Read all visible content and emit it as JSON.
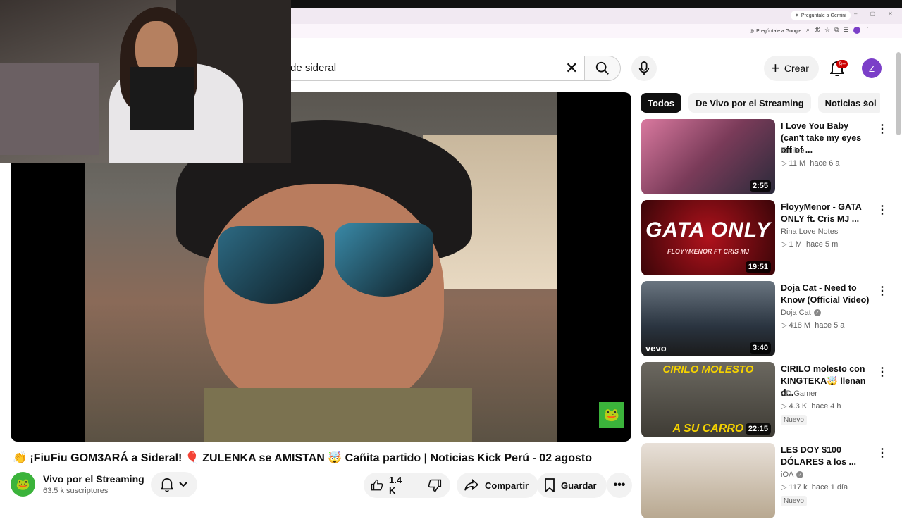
{
  "browser": {
    "gemini_button": "Pregúntale a Gemini",
    "ask_google": "Pregúntale a Google",
    "win_controls": [
      "–",
      "▢",
      "✕"
    ]
  },
  "header": {
    "search_query": "de sideral",
    "create_label": "Crear",
    "notifications_badge": "9+",
    "avatar_letter": "Z"
  },
  "video": {
    "title": "👏 ¡FiuFiu GOM3ARÁ a Sideral! 🎈 ZULENKA se AMISTAN 🤯 Cañita partido | Noticias Kick Perú - 02 agosto",
    "channel_name": "Vivo por el Streaming",
    "subscribers": "63.5 k suscriptores",
    "likes": "1.4 K",
    "share_label": "Compartir",
    "save_label": "Guardar"
  },
  "chips": [
    "Todos",
    "De Vivo por el Streaming",
    "Noticias sol"
  ],
  "recommendations": [
    {
      "title": "I Love You Baby (can't take my eyes off of ...",
      "channel": "Emilee",
      "verified": false,
      "views": "11 M",
      "age": "hace 6 a",
      "duration": "2:55",
      "new": "",
      "thumb_text": "",
      "thumb_color": "#c66a92"
    },
    {
      "title": "FloyyMenor - GATA ONLY ft. Cris MJ ...",
      "channel": "Rina Love Notes",
      "verified": false,
      "views": "1 M",
      "age": "hace 5 m",
      "duration": "19:51",
      "new": "",
      "thumb_text": "GATA ONLY",
      "thumb_sub": "FLOYYMENOR FT CRIS MJ",
      "thumb_color": "#8c0d14"
    },
    {
      "title": "Doja Cat - Need to Know (Official Video)",
      "channel": "Doja Cat",
      "verified": true,
      "views": "418 M",
      "age": "hace 5 a",
      "duration": "3:40",
      "new": "",
      "thumb_text": "vevo",
      "thumb_color": "#2a3a4a"
    },
    {
      "title": "CIRILO molesto con KINGTEKA🤯 llenan d...",
      "channel": "AD Gamer",
      "verified": false,
      "views": "4.3 K",
      "age": "hace 4 h",
      "duration": "22:15",
      "new": "Nuevo",
      "thumb_text": "CIRILO MOLESTO",
      "thumb_sub": "A SU CARRO",
      "thumb_color": "#5a5a50"
    },
    {
      "title": "LES DOY $100 DÓLARES a los ...",
      "channel": "iOA",
      "verified": true,
      "views": "117 k",
      "age": "hace 1 día",
      "duration": "",
      "new": "Nuevo",
      "thumb_text": "",
      "thumb_color": "#d8d0c8"
    }
  ]
}
